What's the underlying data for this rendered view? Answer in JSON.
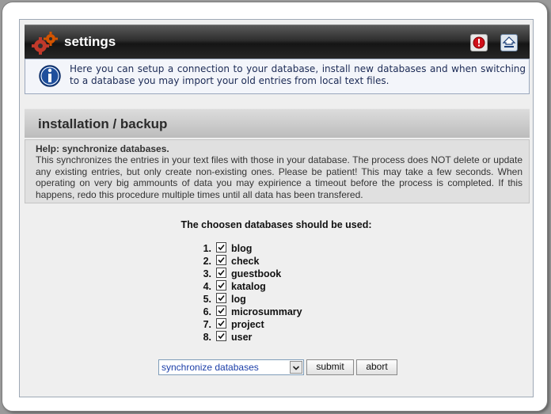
{
  "header": {
    "title": "settings",
    "help_icon": "help-icon",
    "home_icon": "home-icon"
  },
  "info": {
    "icon": "info-icon",
    "text": "Here you can setup a connection to your database, install new databases and when switching to a database you may import your old entries from local text files."
  },
  "section": {
    "title": "installation / backup"
  },
  "help": {
    "heading": "Help:  synchronize databases.",
    "text": "This synchronizes the entries in your text files with those in your database. The process does NOT delete or update any existing entries, but only create non-existing ones. Please be patient! This may take a few seconds. When operating on very big ammounts of data you may expirience a timeout before the process is completed. If this happens, redo this procedure multiple times until all data has been transfered."
  },
  "databases": {
    "title": "The choosen databases should be used:",
    "items": [
      {
        "num": "1.",
        "label": "blog",
        "checked": true
      },
      {
        "num": "2.",
        "label": "check",
        "checked": true
      },
      {
        "num": "3.",
        "label": "guestbook",
        "checked": true
      },
      {
        "num": "4.",
        "label": "katalog",
        "checked": true
      },
      {
        "num": "5.",
        "label": "log",
        "checked": true
      },
      {
        "num": "6.",
        "label": "microsummary",
        "checked": true
      },
      {
        "num": "7.",
        "label": "project",
        "checked": true
      },
      {
        "num": "8.",
        "label": "user",
        "checked": true
      }
    ]
  },
  "controls": {
    "action_select_value": "synchronize databases",
    "submit_label": "submit",
    "abort_label": "abort"
  }
}
